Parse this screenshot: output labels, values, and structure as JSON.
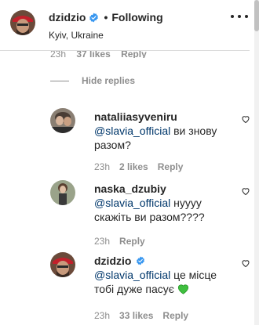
{
  "post_header": {
    "username": "dzidzio",
    "separator": "•",
    "follow_label": "Following",
    "location": "Kyiv, Ukraine"
  },
  "previous_comment_meta": {
    "time": "23h",
    "likes": "37 likes",
    "reply": "Reply"
  },
  "hide_replies_label": "Hide replies",
  "replies": [
    {
      "username": "nataliiasyveniru",
      "mention": "@slavia_official",
      "text": " ви знову разом?",
      "time": "23h",
      "likes": "2 likes",
      "reply": "Reply"
    },
    {
      "username": "naska_dzubiy",
      "mention": "@slavia_official",
      "text": " нуууу скажіть ви разом????",
      "time": "23h",
      "likes": "",
      "reply": "Reply"
    },
    {
      "username": "dzidzio",
      "mention": "@slavia_official",
      "text": " це місце тобі дуже пасує",
      "time": "23h",
      "likes": "33 likes",
      "reply": "Reply"
    }
  ],
  "icons": {
    "verified": "verified-badge-icon",
    "more": "more-options-icon",
    "heart": "heart-outline-icon",
    "green_heart": "green-heart-emoji"
  },
  "colors": {
    "verified_blue": "#3897f0",
    "mention_blue": "#00376b",
    "muted_gray": "#8e8e8e",
    "green_heart": "#3fbf3f"
  }
}
